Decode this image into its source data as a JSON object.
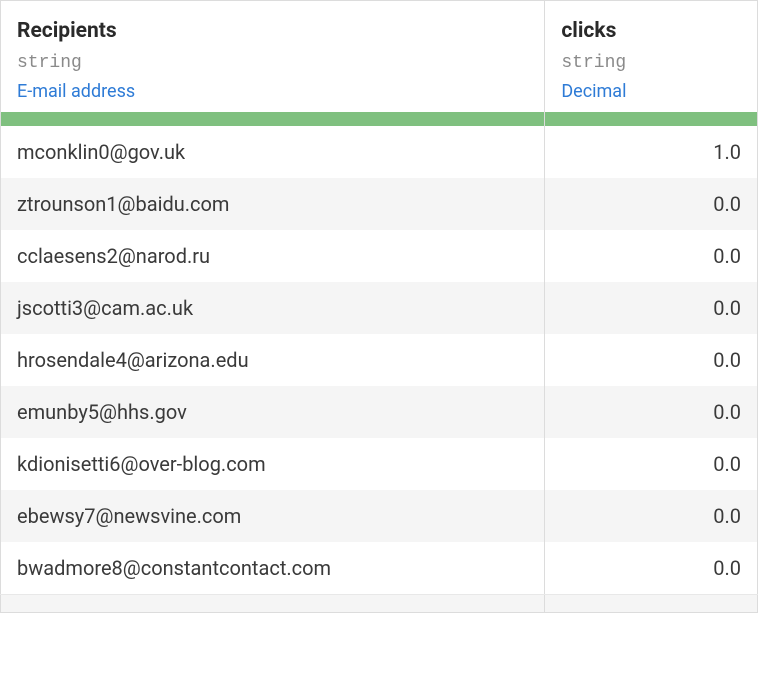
{
  "columns": [
    {
      "header": "Recipients",
      "data_type": "string",
      "semantic_type": "E-mail address"
    },
    {
      "header": "clicks",
      "data_type": "string",
      "semantic_type": "Decimal"
    }
  ],
  "rows": [
    {
      "recipients": "mconklin0@gov.uk",
      "clicks": "1.0"
    },
    {
      "recipients": "ztrounson1@baidu.com",
      "clicks": "0.0"
    },
    {
      "recipients": "cclaesens2@narod.ru",
      "clicks": "0.0"
    },
    {
      "recipients": "jscotti3@cam.ac.uk",
      "clicks": "0.0"
    },
    {
      "recipients": "hrosendale4@arizona.edu",
      "clicks": "0.0"
    },
    {
      "recipients": "emunby5@hhs.gov",
      "clicks": "0.0"
    },
    {
      "recipients": "kdionisetti6@over-blog.com",
      "clicks": "0.0"
    },
    {
      "recipients": "ebewsy7@newsvine.com",
      "clicks": "0.0"
    },
    {
      "recipients": "bwadmore8@constantcontact.com",
      "clicks": "0.0"
    }
  ]
}
